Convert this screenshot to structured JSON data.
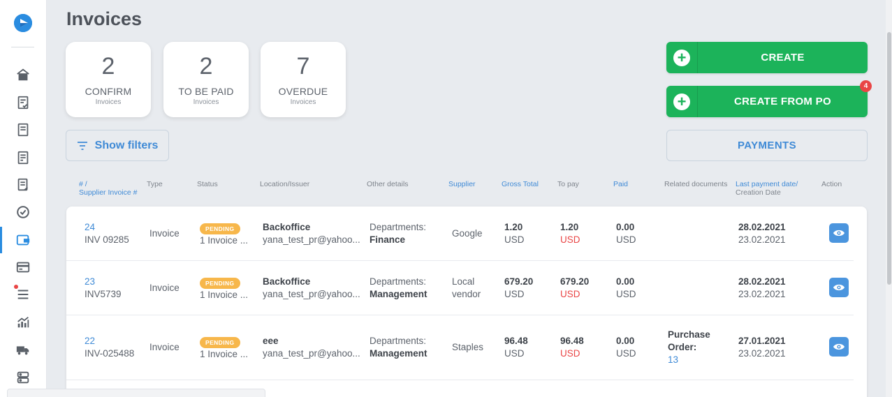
{
  "page": {
    "title": "Invoices"
  },
  "stats": [
    {
      "number": "2",
      "label": "CONFIRM",
      "sub": "Invoices"
    },
    {
      "number": "2",
      "label": "TO BE PAID",
      "sub": "Invoices"
    },
    {
      "number": "7",
      "label": "OVERDUE",
      "sub": "Invoices"
    }
  ],
  "actions": {
    "create": "CREATE",
    "create_from_po": "CREATE FROM PO",
    "create_from_po_badge": "4",
    "payments": "PAYMENTS",
    "show_filters": "Show filters"
  },
  "columns": {
    "number_l1": "# /",
    "number_l2": "Supplier Invoice #",
    "type": "Type",
    "status": "Status",
    "location": "Location/Issuer",
    "other": "Other details",
    "supplier": "Supplier",
    "gross": "Gross Total",
    "topay": "To pay",
    "paid": "Paid",
    "related": "Related documents",
    "lastpay_l1": "Last payment date/",
    "lastpay_l2": "Creation Date",
    "action": "Action"
  },
  "rows": [
    {
      "id": "24",
      "number": "INV 09285",
      "type": "Invoice",
      "status": "PENDING",
      "status_sub": "1 Invoice ...",
      "location": "Backoffice",
      "issuer": "yana_test_pr@yahoo...",
      "dept_label": "Departments:",
      "dept": "Finance",
      "supplier_l1": "Google",
      "supplier_l2": "",
      "gross": "1.20",
      "gross_cur": "USD",
      "topay": "1.20",
      "topay_cur": "USD",
      "paid": "0.00",
      "paid_cur": "USD",
      "related_l1": "",
      "related_l2": "",
      "related_link": "",
      "last_payment": "28.02.2021",
      "created": "23.02.2021"
    },
    {
      "id": "23",
      "number": "INV5739",
      "type": "Invoice",
      "status": "PENDING",
      "status_sub": "1 Invoice ...",
      "location": "Backoffice",
      "issuer": "yana_test_pr@yahoo...",
      "dept_label": "Departments:",
      "dept": "Management",
      "supplier_l1": "Local",
      "supplier_l2": "vendor",
      "gross": "679.20",
      "gross_cur": "USD",
      "topay": "679.20",
      "topay_cur": "USD",
      "paid": "0.00",
      "paid_cur": "USD",
      "related_l1": "",
      "related_l2": "",
      "related_link": "",
      "last_payment": "28.02.2021",
      "created": "23.02.2021"
    },
    {
      "id": "22",
      "number": "INV-025488",
      "type": "Invoice",
      "status": "PENDING",
      "status_sub": "1 Invoice ...",
      "location": "eee",
      "issuer": "yana_test_pr@yahoo...",
      "dept_label": "Departments:",
      "dept": "Management",
      "supplier_l1": "Staples",
      "supplier_l2": "",
      "gross": "96.48",
      "gross_cur": "USD",
      "topay": "96.48",
      "topay_cur": "USD",
      "paid": "0.00",
      "paid_cur": "USD",
      "related_l1": "Purchase",
      "related_l2": "Order:",
      "related_link": "13",
      "last_payment": "27.01.2021",
      "created": "23.02.2021"
    }
  ],
  "colors": {
    "accent": "#3f8ad6",
    "green": "#1cb35a",
    "pending": "#f7b74b",
    "danger": "#e94545"
  },
  "icons": [
    "logo-icon",
    "home-icon",
    "checklist-icon",
    "document-icon",
    "document-icon",
    "receipt-icon",
    "check-circle-icon",
    "wallet-icon",
    "card-icon",
    "list-icon",
    "chart-icon",
    "truck-icon",
    "server-icon",
    "filter-icon",
    "plus-icon",
    "eye-icon"
  ]
}
